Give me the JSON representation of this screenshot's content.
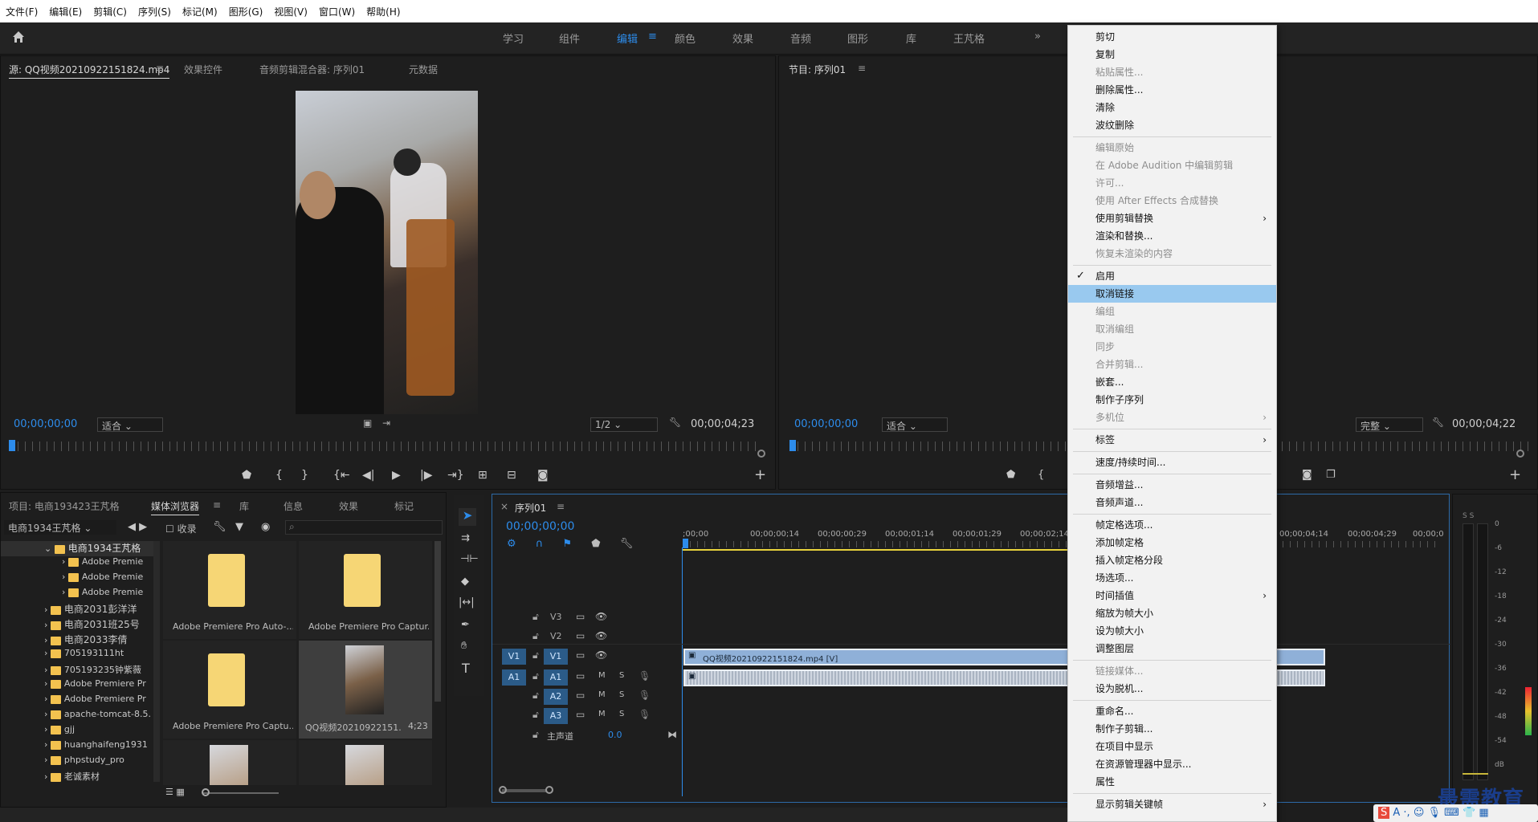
{
  "menubar": {
    "items": [
      "文件(F)",
      "编辑(E)",
      "剪辑(C)",
      "序列(S)",
      "标记(M)",
      "图形(G)",
      "视图(V)",
      "窗口(W)",
      "帮助(H)"
    ]
  },
  "workspaces": {
    "items": [
      "学习",
      "组件",
      "编辑",
      "颜色",
      "效果",
      "音频",
      "图形",
      "库",
      "王芃格"
    ],
    "active": "编辑",
    "more": "»"
  },
  "source_panel": {
    "tabs": [
      "源: QQ视频20210922151824.mp4",
      "效果控件",
      "音频剪辑混合器: 序列01",
      "元数据"
    ],
    "timecode": "00;00;00;00",
    "fit": "适合",
    "resolution": "1/2",
    "duration": "00;00;04;23"
  },
  "program_panel": {
    "title": "节目: 序列01",
    "timecode": "00;00;00;00",
    "fit": "适合",
    "quality": "完整",
    "duration": "00;00;04;22"
  },
  "project_panel": {
    "tabs": [
      "项目: 电商193423王芃格",
      "媒体浏览器",
      "库",
      "信息",
      "效果",
      "标记"
    ],
    "location": "电商1934王芃格",
    "favorites": "收录",
    "search_placeholder": "",
    "tree": [
      "电商1934王芃格",
      "Adobe Premie",
      "Adobe Premie",
      "Adobe Premie",
      "电商2031彭洋洋",
      "电商2031班25号",
      "电商2033李倩",
      "705193111ht",
      "705193235钟紫薇",
      "Adobe Premiere Pr",
      "Adobe Premiere Pr",
      "apache-tomcat-8.5.",
      "gjj",
      "huanghaifeng1931",
      "phpstudy_pro",
      "老诚素材"
    ],
    "thumbs": [
      {
        "name": "Adobe Premiere Pro Auto-..."
      },
      {
        "name": "Adobe Premiere Pro Captur..."
      },
      {
        "name": "Adobe Premiere Pro Captu..."
      },
      {
        "name": "QQ视频20210922151...",
        "dur": "4;23"
      }
    ]
  },
  "timeline": {
    "tab": "序列01",
    "timecode": "00;00;00;00",
    "ruler": [
      ";00;00",
      "00;00;00;14",
      "00;00;00;29",
      "00;00;01;14",
      "00;00;01;29",
      "00;00;02;14",
      "00;00;04;14",
      "00;00;04;29",
      "00;00;0"
    ],
    "tracks": {
      "v3": "V3",
      "v2": "V2",
      "v1": "V1",
      "v1src": "V1",
      "a1": "A1",
      "a1src": "A1",
      "a2": "A2",
      "a3": "A3",
      "master": "主声道",
      "master_val": "0.0"
    },
    "clip_name": "QQ视频20210922151824.mp4 [V]"
  },
  "meter": {
    "labels": [
      "0",
      "-6",
      "-12",
      "-18",
      "-24",
      "-30",
      "-36",
      "-42",
      "-48",
      "-54",
      "dB"
    ],
    "solo": "S S"
  },
  "context_menu": {
    "items": [
      {
        "label": "剪切",
        "state": "enabled"
      },
      {
        "label": "复制",
        "state": "enabled"
      },
      {
        "label": "粘贴属性...",
        "state": "disabled"
      },
      {
        "label": "删除属性...",
        "state": "enabled"
      },
      {
        "label": "清除",
        "state": "enabled"
      },
      {
        "label": "波纹删除",
        "state": "enabled"
      },
      {
        "label": "编辑原始",
        "state": "disabled"
      },
      {
        "label": "在 Adobe Audition 中编辑剪辑",
        "state": "disabled"
      },
      {
        "label": "许可...",
        "state": "disabled"
      },
      {
        "label": "使用 After Effects 合成替换",
        "state": "disabled"
      },
      {
        "label": "使用剪辑替换",
        "state": "enabled",
        "submenu": true
      },
      {
        "label": "渲染和替换...",
        "state": "enabled"
      },
      {
        "label": "恢复未渲染的内容",
        "state": "disabled"
      },
      {
        "label": "启用",
        "state": "enabled",
        "checked": true
      },
      {
        "label": "取消链接",
        "state": "enabled",
        "highlight": true
      },
      {
        "label": "编组",
        "state": "disabled"
      },
      {
        "label": "取消编组",
        "state": "disabled"
      },
      {
        "label": "同步",
        "state": "disabled"
      },
      {
        "label": "合并剪辑...",
        "state": "disabled"
      },
      {
        "label": "嵌套...",
        "state": "enabled"
      },
      {
        "label": "制作子序列",
        "state": "enabled"
      },
      {
        "label": "多机位",
        "state": "disabled",
        "submenu": true
      },
      {
        "label": "标签",
        "state": "enabled",
        "submenu": true
      },
      {
        "label": "速度/持续时间...",
        "state": "enabled"
      },
      {
        "label": "音频增益...",
        "state": "enabled"
      },
      {
        "label": "音频声道...",
        "state": "enabled"
      },
      {
        "label": "帧定格选项...",
        "state": "enabled"
      },
      {
        "label": "添加帧定格",
        "state": "enabled"
      },
      {
        "label": "插入帧定格分段",
        "state": "enabled"
      },
      {
        "label": "场选项...",
        "state": "enabled"
      },
      {
        "label": "时间插值",
        "state": "enabled",
        "submenu": true
      },
      {
        "label": "缩放为帧大小",
        "state": "enabled"
      },
      {
        "label": "设为帧大小",
        "state": "enabled"
      },
      {
        "label": "调整图层",
        "state": "enabled"
      },
      {
        "label": "链接媒体...",
        "state": "disabled"
      },
      {
        "label": "设为脱机...",
        "state": "enabled"
      },
      {
        "label": "重命名...",
        "state": "enabled"
      },
      {
        "label": "制作子剪辑...",
        "state": "enabled"
      },
      {
        "label": "在项目中显示",
        "state": "enabled"
      },
      {
        "label": "在资源管理器中显示...",
        "state": "enabled"
      },
      {
        "label": "属性",
        "state": "enabled"
      },
      {
        "label": "显示剪辑关键帧",
        "state": "enabled",
        "submenu": true
      }
    ]
  },
  "watermark": "最需教育",
  "colors": {
    "accent": "#2d8ceb",
    "highlight": "#99c9ef",
    "clip_video": "#8fb0d8",
    "clip_audio": "#d6dbe3"
  }
}
